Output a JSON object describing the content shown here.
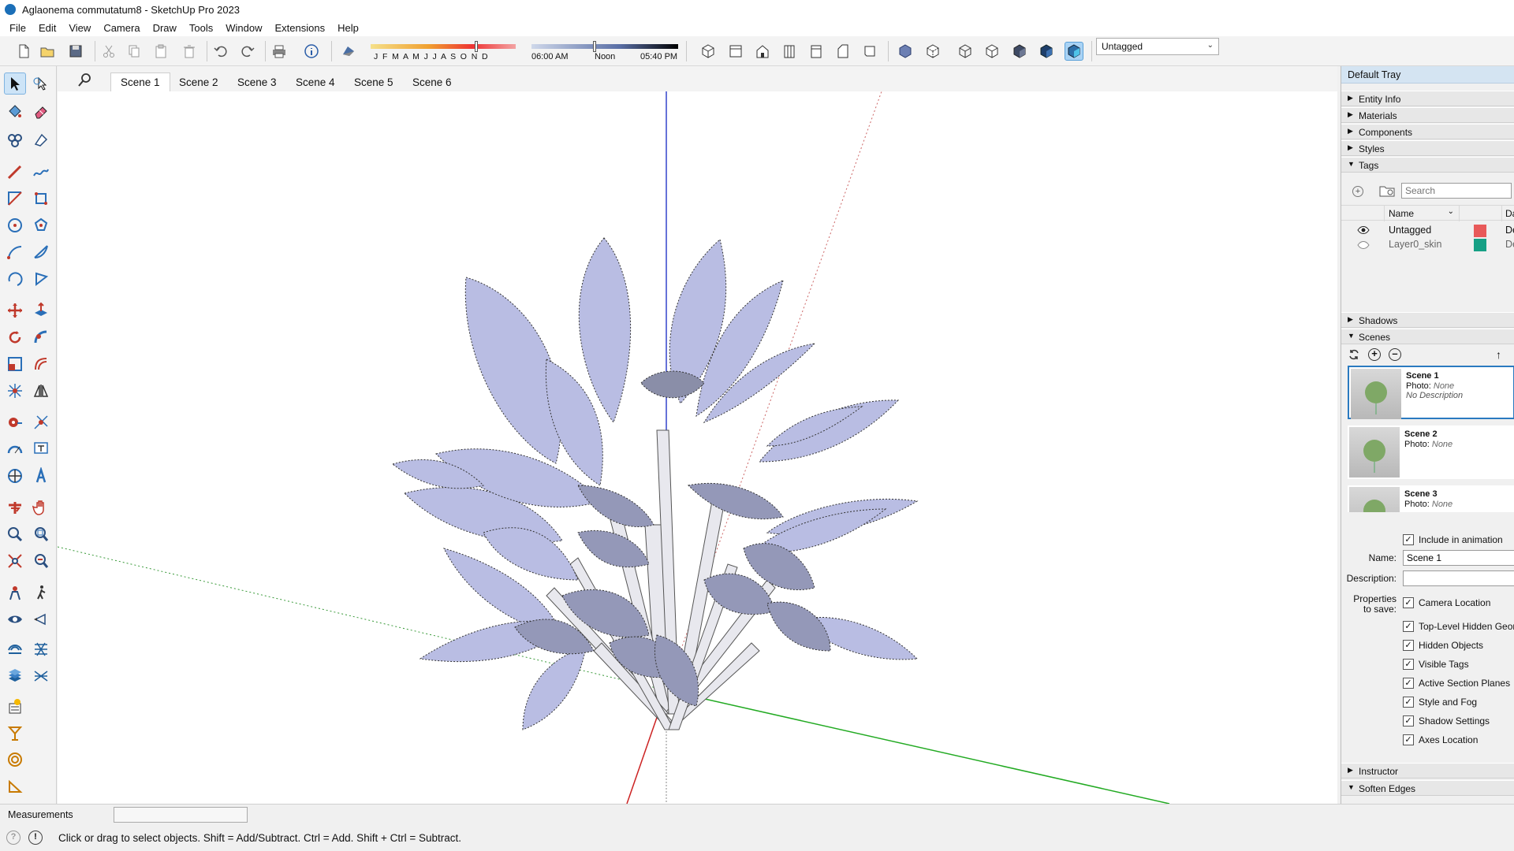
{
  "window": {
    "title": "Aglaonema commutatum8 - SketchUp Pro 2023"
  },
  "menu": [
    "File",
    "Edit",
    "View",
    "Camera",
    "Draw",
    "Tools",
    "Window",
    "Extensions",
    "Help"
  ],
  "shadow_toolbar": {
    "months": "J F M A M J J A S O N D",
    "time_start": "06:00 AM",
    "time_mid": "Noon",
    "time_end": "05:40 PM"
  },
  "tag_select": {
    "value": "Untagged"
  },
  "scene_tabs": [
    "Scene 1",
    "Scene 2",
    "Scene 3",
    "Scene 4",
    "Scene 5",
    "Scene 6"
  ],
  "active_scene_tab": "Scene 1",
  "tray": {
    "title": "Default Tray",
    "panels_top": [
      "Entity Info",
      "Materials",
      "Components",
      "Styles",
      "Tags"
    ],
    "tags": {
      "search_placeholder": "Search",
      "col_name": "Name",
      "col_extra": "Da",
      "rows": [
        {
          "name": "Untagged",
          "color": "#e85a5a",
          "extra": "De"
        },
        {
          "name": "Layer0_skin",
          "color": "#16a085",
          "extra": "De"
        }
      ]
    },
    "panels_mid": [
      "Shadows",
      "Scenes"
    ],
    "scenes": [
      {
        "name": "Scene 1",
        "photo_label": "Photo:",
        "photo_value": "None",
        "desc": "No Description"
      },
      {
        "name": "Scene 2",
        "photo_label": "Photo:",
        "photo_value": "None",
        "desc": ""
      },
      {
        "name": "Scene 3",
        "photo_label": "Photo:",
        "photo_value": "None",
        "desc": ""
      }
    ],
    "include_animation": "Include in animation",
    "name_label": "Name:",
    "name_value": "Scene 1",
    "description_label": "Description:",
    "properties_label_1": "Properties",
    "properties_label_2": "to save:",
    "properties": [
      "Camera Location",
      "Top-Level Hidden Geome",
      "Hidden Objects",
      "Visible Tags",
      "Active Section Planes",
      "Style and Fog",
      "Shadow Settings",
      "Axes Location"
    ],
    "panels_bottom": [
      "Instructor",
      "Soften Edges"
    ]
  },
  "status": {
    "measurements_label": "Measurements",
    "hint": "Click or drag to select objects. Shift = Add/Subtract. Ctrl = Add. Shift + Ctrl = Subtract."
  },
  "colors": {
    "accent": "#1b6fb8",
    "axis_blue": "#3344cc",
    "axis_green": "#22aa22",
    "axis_red": "#cc2222",
    "leaf_fill": "#b9bde3"
  }
}
